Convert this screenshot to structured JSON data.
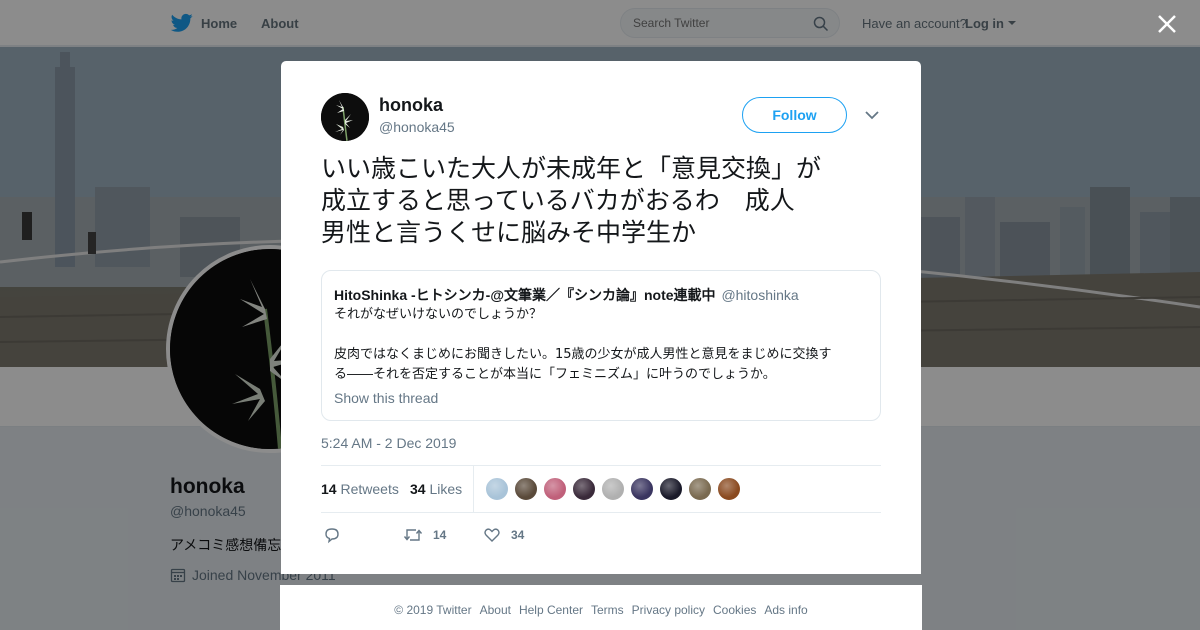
{
  "nav": {
    "home_label": "Home",
    "about_label": "About",
    "search_placeholder": "Search Twitter",
    "have_account": "Have an account?",
    "login_label": "Log in"
  },
  "profile": {
    "name": "honoka",
    "handle": "@honoka45",
    "bio": "アメコミ感想備忘",
    "joined": "Joined November 2011"
  },
  "tweet": {
    "name": "honoka",
    "handle": "@honoka45",
    "follow_label": "Follow",
    "text": "いい歳こいた大人が未成年と「意見交換」が\n成立すると思っているバカがおるわ　成人\n男性と言うくせに脳みそ中学生か",
    "quote": {
      "name": "HitoShinka -ヒトシンカ-@文筆業／『シンカ論』note連載中",
      "handle": "@hitoshinka",
      "text": "それがなぜいけないのでしょうか？\n\n皮肉ではなくまじめにお聞きしたい。15歳の少女が成人男性と意見をまじめに交換す\nる――それを否定することが本当に「フェミニズム」に叶うのでしょうか。",
      "show_thread": "Show this thread"
    },
    "timestamp": "5:24 AM - 2 Dec 2019",
    "retweets_count": "14",
    "retweets_label": "Retweets",
    "likes_count": "34",
    "likes_label": "Likes",
    "liker_avatar_colors": [
      "#a8c3d8",
      "#5a4a3a",
      "#c0607a",
      "#3a2a3a",
      "#b0b0b0",
      "#3a3560",
      "#1a1a2a",
      "#7a6a50",
      "#8a4a20"
    ],
    "action_retweet_count": "14",
    "action_like_count": "34"
  },
  "footer": {
    "links": [
      "© 2019 Twitter",
      "About",
      "Help Center",
      "Terms",
      "Privacy policy",
      "Cookies",
      "Ads info"
    ]
  },
  "colors": {
    "accent": "#1da1f2",
    "text_primary": "#14171a",
    "text_secondary": "#657786"
  }
}
